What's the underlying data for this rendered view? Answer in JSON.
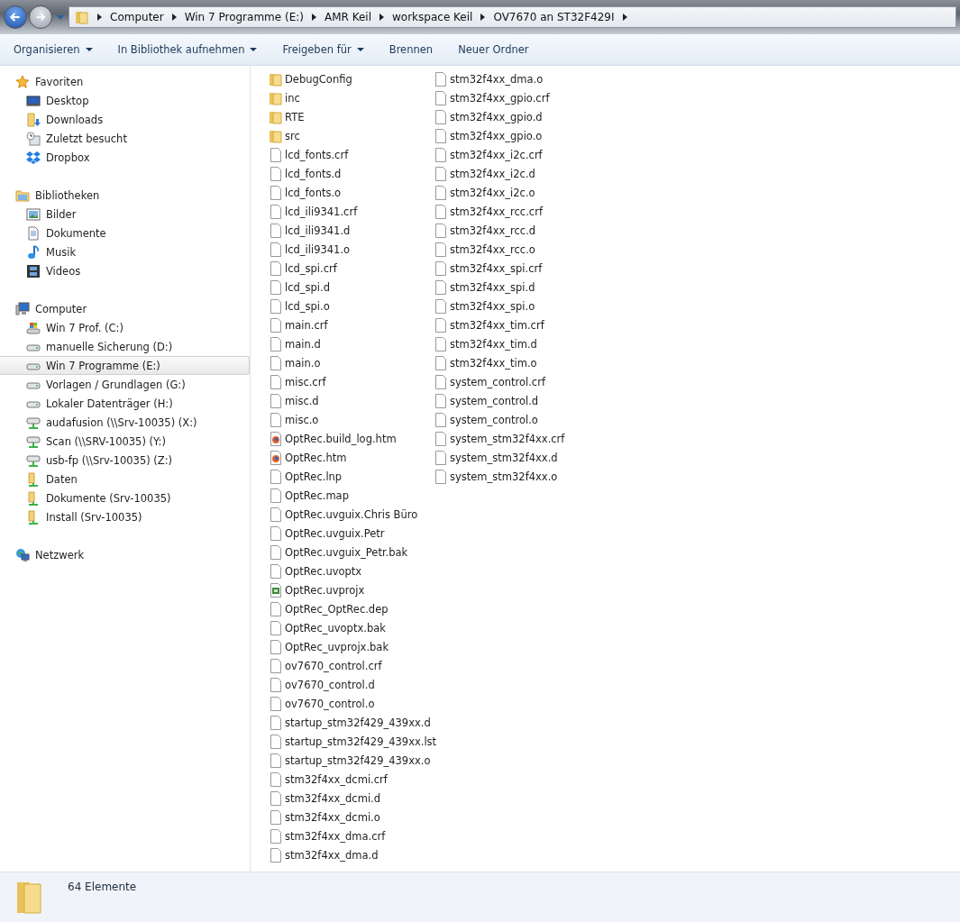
{
  "address_bar": {
    "breadcrumbs": [
      "Computer",
      "Win 7 Programme (E:)",
      "AMR Keil",
      "workspace Keil",
      "OV7670 an ST32F429I"
    ]
  },
  "toolbar": [
    {
      "label": "Organisieren",
      "dropdown": true
    },
    {
      "label": "In Bibliothek aufnehmen",
      "dropdown": true
    },
    {
      "label": "Freigeben für",
      "dropdown": true
    },
    {
      "label": "Brennen",
      "dropdown": false
    },
    {
      "label": "Neuer Ordner",
      "dropdown": false
    }
  ],
  "sidebar": [
    {
      "label": "Favoriten",
      "kind": "favorites",
      "children": [
        {
          "label": "Desktop",
          "kind": "desktop",
          "selected": false
        },
        {
          "label": "Downloads",
          "kind": "downloads",
          "selected": false
        },
        {
          "label": "Zuletzt besucht",
          "kind": "recent",
          "selected": false
        },
        {
          "label": "Dropbox",
          "kind": "dropbox",
          "selected": false
        }
      ]
    },
    {
      "label": "Bibliotheken",
      "kind": "libraries",
      "children": [
        {
          "label": "Bilder",
          "kind": "pictures",
          "selected": false
        },
        {
          "label": "Dokumente",
          "kind": "documents",
          "selected": false
        },
        {
          "label": "Musik",
          "kind": "music",
          "selected": false
        },
        {
          "label": "Videos",
          "kind": "videos",
          "selected": false
        }
      ]
    },
    {
      "label": "Computer",
      "kind": "computer",
      "children": [
        {
          "label": "Win 7 Prof. (C:)",
          "kind": "system-drive",
          "selected": false
        },
        {
          "label": "manuelle Sicherung (D:)",
          "kind": "drive",
          "selected": false
        },
        {
          "label": "Win 7 Programme (E:)",
          "kind": "drive",
          "selected": true
        },
        {
          "label": "Vorlagen / Grundlagen (G:)",
          "kind": "drive",
          "selected": false
        },
        {
          "label": "Lokaler Datenträger (H:)",
          "kind": "drive",
          "selected": false
        },
        {
          "label": "audafusion (\\\\Srv-10035) (X:)",
          "kind": "network-drive",
          "selected": false
        },
        {
          "label": "Scan (\\\\SRV-10035) (Y:)",
          "kind": "network-drive",
          "selected": false
        },
        {
          "label": "usb-fp (\\\\Srv-10035) (Z:)",
          "kind": "network-drive",
          "selected": false
        },
        {
          "label": "Daten",
          "kind": "network-folder",
          "selected": false
        },
        {
          "label": "Dokumente (Srv-10035)",
          "kind": "network-folder",
          "selected": false
        },
        {
          "label": "Install (Srv-10035)",
          "kind": "network-folder",
          "selected": false
        }
      ]
    },
    {
      "label": "Netzwerk",
      "kind": "network"
    }
  ],
  "files": [
    {
      "name": "DebugConfig",
      "kind": "folder"
    },
    {
      "name": "inc",
      "kind": "folder"
    },
    {
      "name": "RTE",
      "kind": "folder"
    },
    {
      "name": "src",
      "kind": "folder"
    },
    {
      "name": "lcd_fonts.crf",
      "kind": "file"
    },
    {
      "name": "lcd_fonts.d",
      "kind": "file"
    },
    {
      "name": "lcd_fonts.o",
      "kind": "file"
    },
    {
      "name": "lcd_ili9341.crf",
      "kind": "file"
    },
    {
      "name": "lcd_ili9341.d",
      "kind": "file"
    },
    {
      "name": "lcd_ili9341.o",
      "kind": "file"
    },
    {
      "name": "lcd_spi.crf",
      "kind": "file"
    },
    {
      "name": "lcd_spi.d",
      "kind": "file"
    },
    {
      "name": "lcd_spi.o",
      "kind": "file"
    },
    {
      "name": "main.crf",
      "kind": "file"
    },
    {
      "name": "main.d",
      "kind": "file"
    },
    {
      "name": "main.o",
      "kind": "file"
    },
    {
      "name": "misc.crf",
      "kind": "file"
    },
    {
      "name": "misc.d",
      "kind": "file"
    },
    {
      "name": "misc.o",
      "kind": "file"
    },
    {
      "name": "OptRec.build_log.htm",
      "kind": "web"
    },
    {
      "name": "OptRec.htm",
      "kind": "web"
    },
    {
      "name": "OptRec.lnp",
      "kind": "file"
    },
    {
      "name": "OptRec.map",
      "kind": "file"
    },
    {
      "name": "OptRec.uvguix.Chris Büro",
      "kind": "file"
    },
    {
      "name": "OptRec.uvguix.Petr",
      "kind": "file"
    },
    {
      "name": "OptRec.uvguix_Petr.bak",
      "kind": "file"
    },
    {
      "name": "OptRec.uvoptx",
      "kind": "file"
    },
    {
      "name": "OptRec.uvprojx",
      "kind": "project"
    },
    {
      "name": "OptRec_OptRec.dep",
      "kind": "file"
    },
    {
      "name": "OptRec_uvoptx.bak",
      "kind": "file"
    },
    {
      "name": "OptRec_uvprojx.bak",
      "kind": "file"
    },
    {
      "name": "ov7670_control.crf",
      "kind": "file"
    },
    {
      "name": "ov7670_control.d",
      "kind": "file"
    },
    {
      "name": "ov7670_control.o",
      "kind": "file"
    },
    {
      "name": "startup_stm32f429_439xx.d",
      "kind": "file"
    },
    {
      "name": "startup_stm32f429_439xx.lst",
      "kind": "file"
    },
    {
      "name": "startup_stm32f429_439xx.o",
      "kind": "file"
    },
    {
      "name": "stm32f4xx_dcmi.crf",
      "kind": "file"
    },
    {
      "name": "stm32f4xx_dcmi.d",
      "kind": "file"
    },
    {
      "name": "stm32f4xx_dcmi.o",
      "kind": "file"
    },
    {
      "name": "stm32f4xx_dma.crf",
      "kind": "file"
    },
    {
      "name": "stm32f4xx_dma.d",
      "kind": "file"
    },
    {
      "name": "stm32f4xx_dma.o",
      "kind": "file"
    },
    {
      "name": "stm32f4xx_gpio.crf",
      "kind": "file"
    },
    {
      "name": "stm32f4xx_gpio.d",
      "kind": "file"
    },
    {
      "name": "stm32f4xx_gpio.o",
      "kind": "file"
    },
    {
      "name": "stm32f4xx_i2c.crf",
      "kind": "file"
    },
    {
      "name": "stm32f4xx_i2c.d",
      "kind": "file"
    },
    {
      "name": "stm32f4xx_i2c.o",
      "kind": "file"
    },
    {
      "name": "stm32f4xx_rcc.crf",
      "kind": "file"
    },
    {
      "name": "stm32f4xx_rcc.d",
      "kind": "file"
    },
    {
      "name": "stm32f4xx_rcc.o",
      "kind": "file"
    },
    {
      "name": "stm32f4xx_spi.crf",
      "kind": "file"
    },
    {
      "name": "stm32f4xx_spi.d",
      "kind": "file"
    },
    {
      "name": "stm32f4xx_spi.o",
      "kind": "file"
    },
    {
      "name": "stm32f4xx_tim.crf",
      "kind": "file"
    },
    {
      "name": "stm32f4xx_tim.d",
      "kind": "file"
    },
    {
      "name": "stm32f4xx_tim.o",
      "kind": "file"
    },
    {
      "name": "system_control.crf",
      "kind": "file"
    },
    {
      "name": "system_control.d",
      "kind": "file"
    },
    {
      "name": "system_control.o",
      "kind": "file"
    },
    {
      "name": "system_stm32f4xx.crf",
      "kind": "file"
    },
    {
      "name": "system_stm32f4xx.d",
      "kind": "file"
    },
    {
      "name": "system_stm32f4xx.o",
      "kind": "file"
    }
  ],
  "status_bar": {
    "count": "64 Elemente"
  }
}
